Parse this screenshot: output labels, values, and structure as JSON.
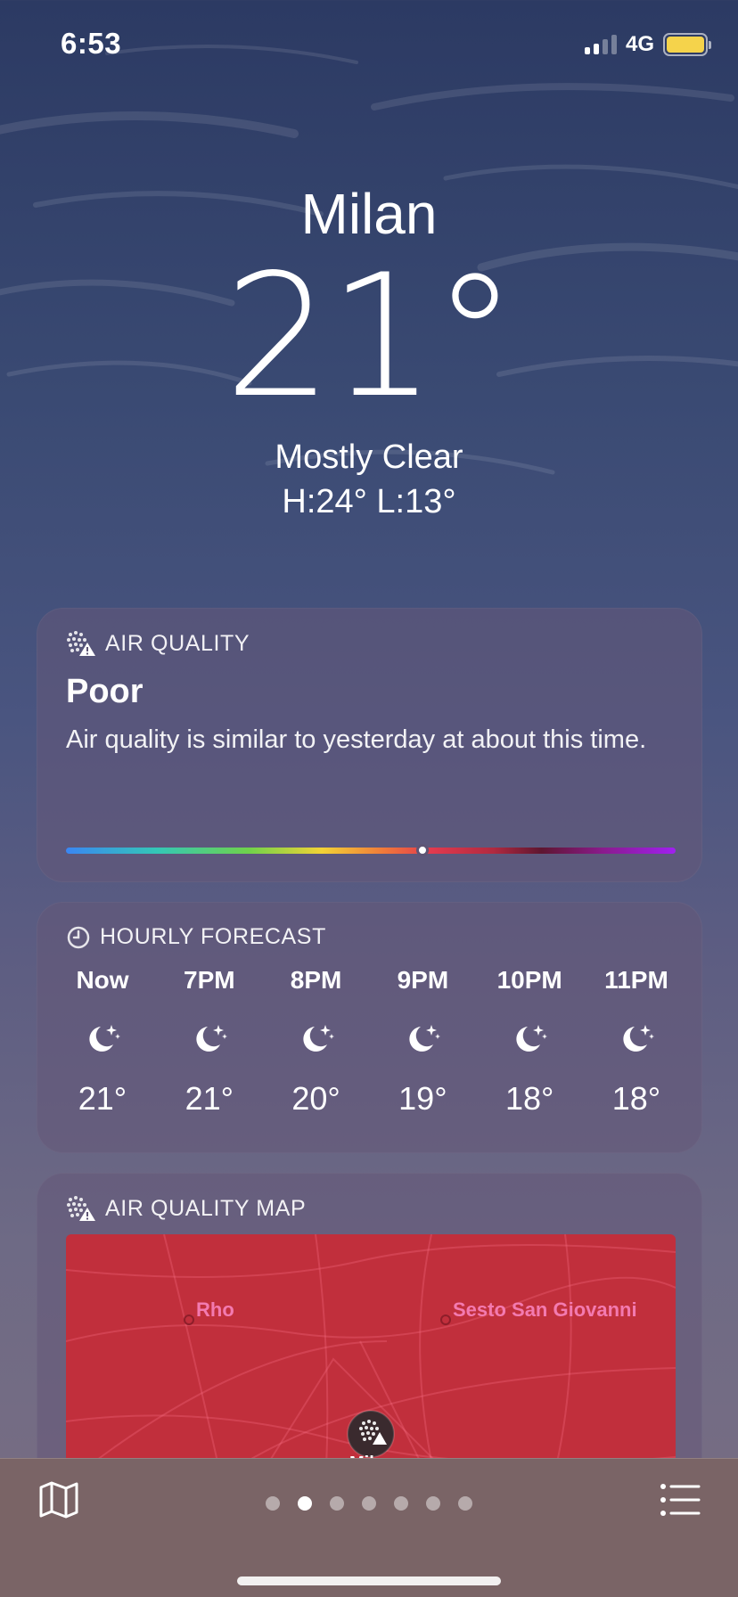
{
  "status_bar": {
    "time": "6:53",
    "network": "4G"
  },
  "location": {
    "city": "Milan",
    "temperature": "21°",
    "condition": "Mostly Clear",
    "high_low": "H:24°  L:13°"
  },
  "air_quality": {
    "header": "AIR QUALITY",
    "icon": "air-quality-icon",
    "level": "Poor",
    "description": "Air quality is similar to yesterday at about this time.",
    "scale_position": 0.585
  },
  "hourly": {
    "header": "HOURLY FORECAST",
    "icon": "clock-icon",
    "hours": [
      {
        "label": "Now",
        "icon": "moon-stars-icon",
        "temp": "21°"
      },
      {
        "label": "7PM",
        "icon": "moon-stars-icon",
        "temp": "21°"
      },
      {
        "label": "8PM",
        "icon": "moon-stars-icon",
        "temp": "20°"
      },
      {
        "label": "9PM",
        "icon": "moon-stars-icon",
        "temp": "19°"
      },
      {
        "label": "10PM",
        "icon": "moon-stars-icon",
        "temp": "18°"
      },
      {
        "label": "11PM",
        "icon": "moon-stars-icon",
        "temp": "18°"
      }
    ]
  },
  "aq_map": {
    "header": "AIR QUALITY MAP",
    "places": [
      "Rho",
      "Sesto San Giovanni",
      "Milan"
    ],
    "map_color": "#c12f3c"
  },
  "bottom_bar": {
    "page_count": 7,
    "active_page": 1,
    "map_icon": "map-icon",
    "list_icon": "list-icon"
  }
}
